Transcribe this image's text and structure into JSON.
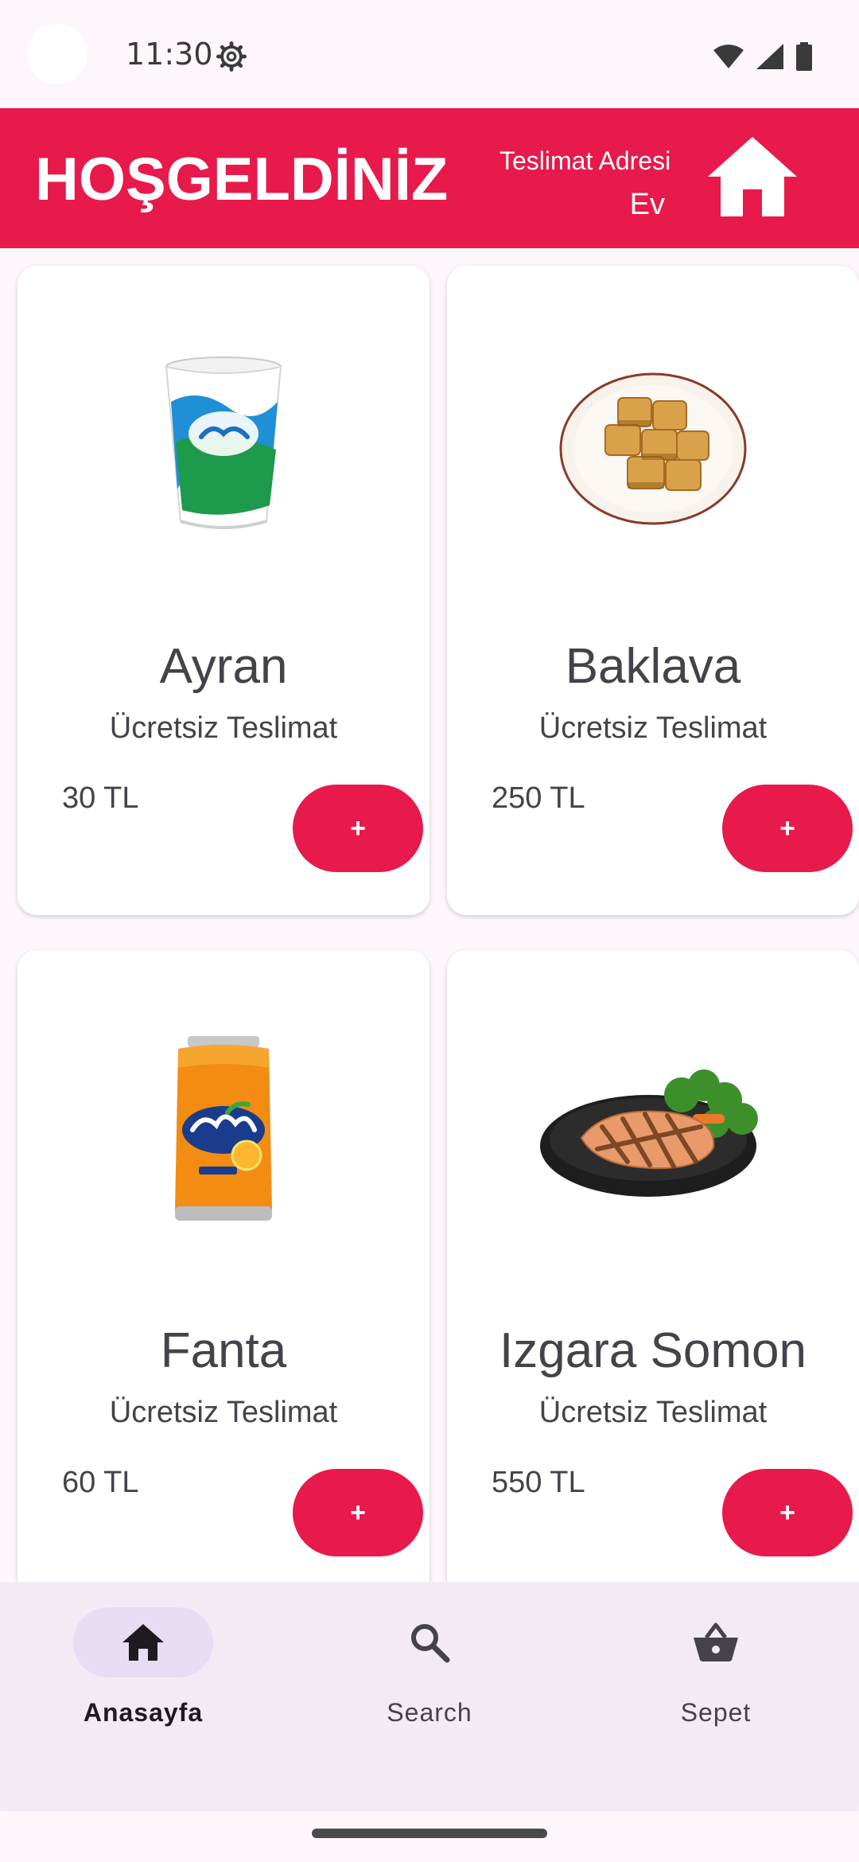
{
  "status_bar": {
    "time": "11:30",
    "icons": [
      "settings-gear-icon",
      "wifi-icon",
      "signal-icon",
      "battery-icon"
    ]
  },
  "header": {
    "title": "HOŞGELDİNİZ",
    "address_label": "Teslimat Adresi",
    "address_value": "Ev",
    "icon": "home-icon",
    "color": "#e8194b"
  },
  "products": [
    {
      "name": "Ayran",
      "delivery": "Ücretsiz Teslimat",
      "price": "30 TL",
      "add_label": "+"
    },
    {
      "name": "Baklava",
      "delivery": "Ücretsiz Teslimat",
      "price": "250 TL",
      "add_label": "+"
    },
    {
      "name": "Fanta",
      "delivery": "Ücretsiz Teslimat",
      "price": "60 TL",
      "add_label": "+"
    },
    {
      "name": "Izgara Somon",
      "delivery": "Ücretsiz Teslimat",
      "price": "550 TL",
      "add_label": "+"
    }
  ],
  "bottom_nav": {
    "items": [
      {
        "label": "Anasayfa",
        "icon": "home-icon",
        "active": true
      },
      {
        "label": "Search",
        "icon": "search-icon",
        "active": false
      },
      {
        "label": "Sepet",
        "icon": "basket-icon",
        "active": false
      }
    ]
  },
  "colors": {
    "accent": "#e8194b",
    "nav_background": "#f2ebf6",
    "nav_active_pill": "#e6dcf3"
  }
}
